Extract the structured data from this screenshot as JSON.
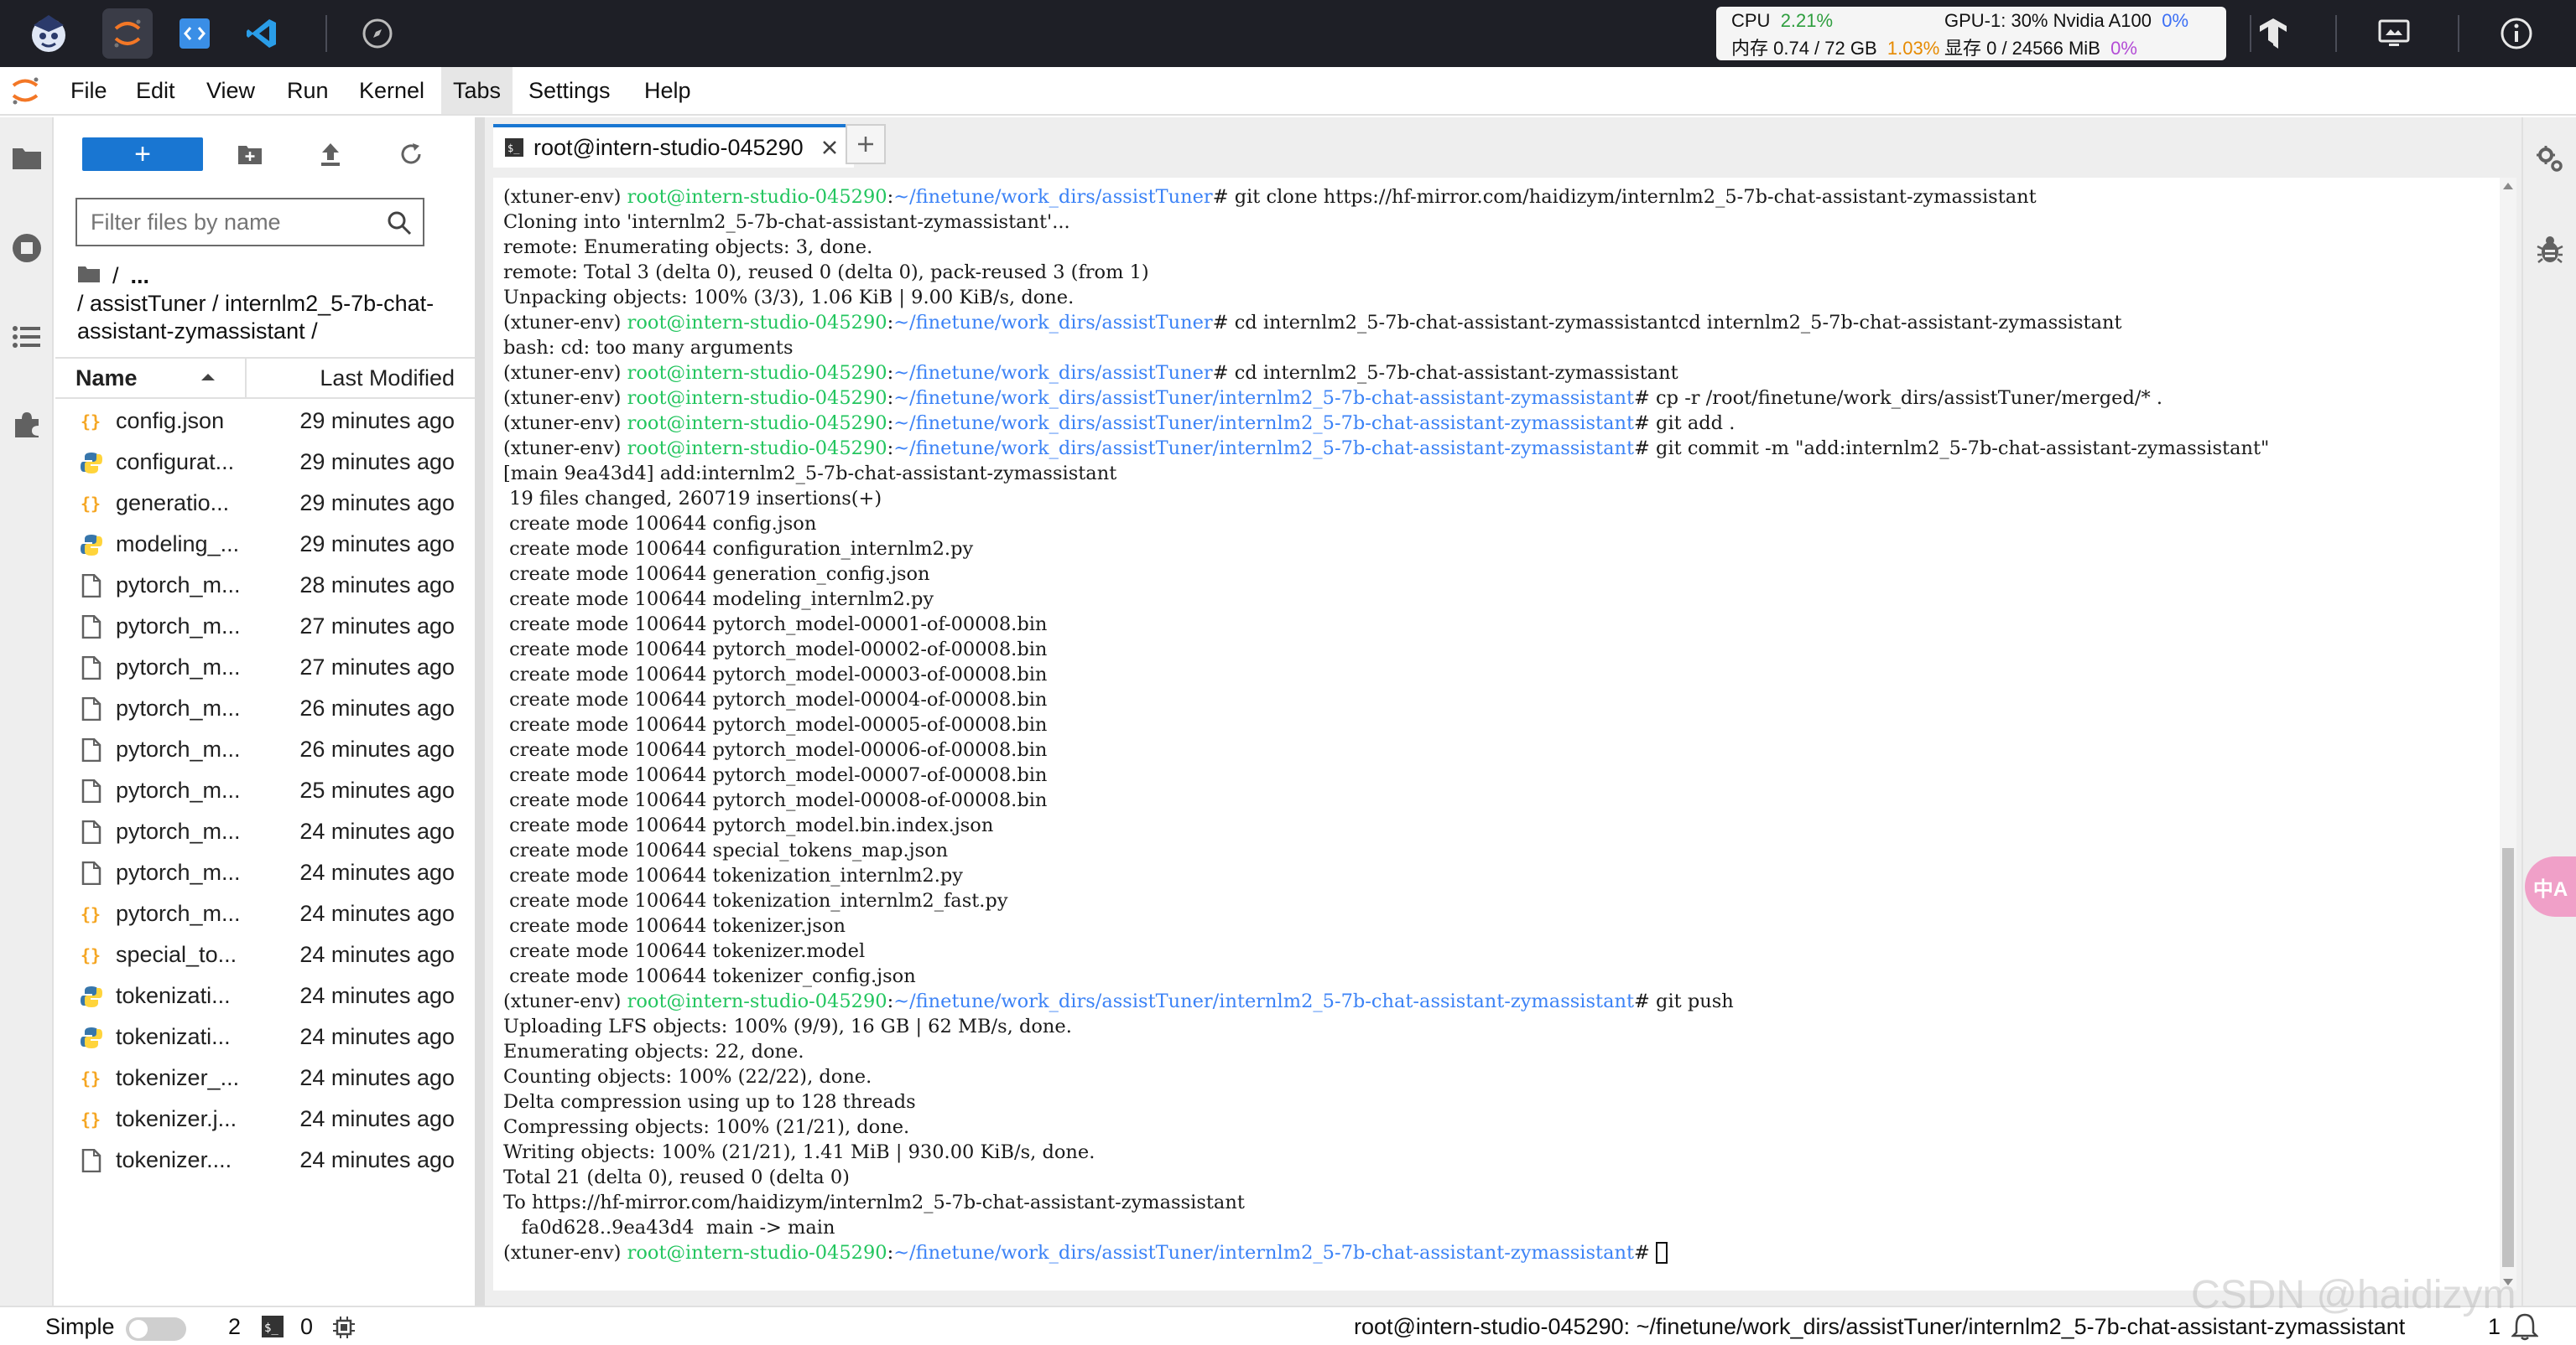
{
  "topbar": {
    "monitor": {
      "cpu_label": "CPU",
      "cpu_value": "2.21%",
      "mem_label": "内存 0.74 / 72 GB",
      "mem_value": "1.03%",
      "gpu_label": "GPU-1: 30% Nvidia A100",
      "gpu_value": "0%",
      "vram_label": "显存 0 / 24566 MiB",
      "vram_value": "0%"
    }
  },
  "menu": {
    "items": [
      "File",
      "Edit",
      "View",
      "Run",
      "Kernel",
      "Tabs",
      "Settings",
      "Help"
    ]
  },
  "filebrowser": {
    "new_button": "+",
    "search_placeholder": "Filter files by name",
    "crumb_root": "/",
    "crumb_ellipsis": "...",
    "path": "/ assistTuner / internlm2_5-7b-chat-assistant-zymassistant /",
    "header_name": "Name",
    "header_modified": "Last Modified",
    "files": [
      {
        "name": "config.json",
        "modified": "29 minutes ago",
        "icon": "json-icon"
      },
      {
        "name": "configurat...",
        "modified": "29 minutes ago",
        "icon": "python-icon"
      },
      {
        "name": "generatio...",
        "modified": "29 minutes ago",
        "icon": "json-icon"
      },
      {
        "name": "modeling_...",
        "modified": "29 minutes ago",
        "icon": "python-icon"
      },
      {
        "name": "pytorch_m...",
        "modified": "28 minutes ago",
        "icon": "file-icon"
      },
      {
        "name": "pytorch_m...",
        "modified": "27 minutes ago",
        "icon": "file-icon"
      },
      {
        "name": "pytorch_m...",
        "modified": "27 minutes ago",
        "icon": "file-icon"
      },
      {
        "name": "pytorch_m...",
        "modified": "26 minutes ago",
        "icon": "file-icon"
      },
      {
        "name": "pytorch_m...",
        "modified": "26 minutes ago",
        "icon": "file-icon"
      },
      {
        "name": "pytorch_m...",
        "modified": "25 minutes ago",
        "icon": "file-icon"
      },
      {
        "name": "pytorch_m...",
        "modified": "24 minutes ago",
        "icon": "file-icon"
      },
      {
        "name": "pytorch_m...",
        "modified": "24 minutes ago",
        "icon": "file-icon"
      },
      {
        "name": "pytorch_m...",
        "modified": "24 minutes ago",
        "icon": "json-icon"
      },
      {
        "name": "special_to...",
        "modified": "24 minutes ago",
        "icon": "json-icon"
      },
      {
        "name": "tokenizati...",
        "modified": "24 minutes ago",
        "icon": "python-icon"
      },
      {
        "name": "tokenizati...",
        "modified": "24 minutes ago",
        "icon": "python-icon"
      },
      {
        "name": "tokenizer_...",
        "modified": "24 minutes ago",
        "icon": "json-icon"
      },
      {
        "name": "tokenizer.j...",
        "modified": "24 minutes ago",
        "icon": "json-icon"
      },
      {
        "name": "tokenizer....",
        "modified": "24 minutes ago",
        "icon": "file-icon"
      }
    ]
  },
  "tabs": {
    "active_label": "root@intern-studio-045290",
    "add_label": "+"
  },
  "terminal": {
    "lines": [
      {
        "env": "(xtuner-env) ",
        "host": "root@intern-studio-045290",
        "sep": ":",
        "path": "~/finetune/work_dirs/assistTuner",
        "cmd": "# git clone https://hf-mirror.com/haidizym/internlm2_5-7b-chat-assistant-zymassistant"
      },
      {
        "text": "Cloning into 'internlm2_5-7b-chat-assistant-zymassistant'..."
      },
      {
        "text": "remote: Enumerating objects: 3, done."
      },
      {
        "text": "remote: Total 3 (delta 0), reused 0 (delta 0), pack-reused 3 (from 1)"
      },
      {
        "text": "Unpacking objects: 100% (3/3), 1.06 KiB | 9.00 KiB/s, done."
      },
      {
        "env": "(xtuner-env) ",
        "host": "root@intern-studio-045290",
        "sep": ":",
        "path": "~/finetune/work_dirs/assistTuner",
        "cmd": "# cd internlm2_5-7b-chat-assistant-zymassistantcd internlm2_5-7b-chat-assistant-zymassistant"
      },
      {
        "text": "bash: cd: too many arguments"
      },
      {
        "env": "(xtuner-env) ",
        "host": "root@intern-studio-045290",
        "sep": ":",
        "path": "~/finetune/work_dirs/assistTuner",
        "cmd": "# cd internlm2_5-7b-chat-assistant-zymassistant"
      },
      {
        "env": "(xtuner-env) ",
        "host": "root@intern-studio-045290",
        "sep": ":",
        "path": "~/finetune/work_dirs/assistTuner/internlm2_5-7b-chat-assistant-zymassistant",
        "cmd": "# cp -r /root/finetune/work_dirs/assistTuner/merged/* ."
      },
      {
        "env": "(xtuner-env) ",
        "host": "root@intern-studio-045290",
        "sep": ":",
        "path": "~/finetune/work_dirs/assistTuner/internlm2_5-7b-chat-assistant-zymassistant",
        "cmd": "# git add ."
      },
      {
        "env": "(xtuner-env) ",
        "host": "root@intern-studio-045290",
        "sep": ":",
        "path": "~/finetune/work_dirs/assistTuner/internlm2_5-7b-chat-assistant-zymassistant",
        "cmd": "# git commit -m \"add:internlm2_5-7b-chat-assistant-zymassistant\""
      },
      {
        "text": "[main 9ea43d4] add:internlm2_5-7b-chat-assistant-zymassistant"
      },
      {
        "text": " 19 files changed, 260719 insertions(+)"
      },
      {
        "text": " create mode 100644 config.json"
      },
      {
        "text": " create mode 100644 configuration_internlm2.py"
      },
      {
        "text": " create mode 100644 generation_config.json"
      },
      {
        "text": " create mode 100644 modeling_internlm2.py"
      },
      {
        "text": " create mode 100644 pytorch_model-00001-of-00008.bin"
      },
      {
        "text": " create mode 100644 pytorch_model-00002-of-00008.bin"
      },
      {
        "text": " create mode 100644 pytorch_model-00003-of-00008.bin"
      },
      {
        "text": " create mode 100644 pytorch_model-00004-of-00008.bin"
      },
      {
        "text": " create mode 100644 pytorch_model-00005-of-00008.bin"
      },
      {
        "text": " create mode 100644 pytorch_model-00006-of-00008.bin"
      },
      {
        "text": " create mode 100644 pytorch_model-00007-of-00008.bin"
      },
      {
        "text": " create mode 100644 pytorch_model-00008-of-00008.bin"
      },
      {
        "text": " create mode 100644 pytorch_model.bin.index.json"
      },
      {
        "text": " create mode 100644 special_tokens_map.json"
      },
      {
        "text": " create mode 100644 tokenization_internlm2.py"
      },
      {
        "text": " create mode 100644 tokenization_internlm2_fast.py"
      },
      {
        "text": " create mode 100644 tokenizer.json"
      },
      {
        "text": " create mode 100644 tokenizer.model"
      },
      {
        "text": " create mode 100644 tokenizer_config.json"
      },
      {
        "env": "(xtuner-env) ",
        "host": "root@intern-studio-045290",
        "sep": ":",
        "path": "~/finetune/work_dirs/assistTuner/internlm2_5-7b-chat-assistant-zymassistant",
        "cmd": "# git push"
      },
      {
        "text": "Uploading LFS objects: 100% (9/9), 16 GB | 62 MB/s, done."
      },
      {
        "text": "Enumerating objects: 22, done."
      },
      {
        "text": "Counting objects: 100% (22/22), done."
      },
      {
        "text": "Delta compression using up to 128 threads"
      },
      {
        "text": "Compressing objects: 100% (21/21), done."
      },
      {
        "text": "Writing objects: 100% (21/21), 1.41 MiB | 930.00 KiB/s, done."
      },
      {
        "text": "Total 21 (delta 0), reused 0 (delta 0)"
      },
      {
        "text": "To https://hf-mirror.com/haidizym/internlm2_5-7b-chat-assistant-zymassistant"
      },
      {
        "text": "   fa0d628..9ea43d4  main -> main"
      },
      {
        "env": "(xtuner-env) ",
        "host": "root@intern-studio-045290",
        "sep": ":",
        "path": "~/finetune/work_dirs/assistTuner/internlm2_5-7b-chat-assistant-zymassistant",
        "cmd": "# ",
        "cursor": true
      }
    ]
  },
  "statusbar": {
    "simple_label": "Simple",
    "kernels_count": "2",
    "terminals_count": "0",
    "path": "root@intern-studio-045290: ~/finetune/work_dirs/assistTuner/internlm2_5-7b-chat-assistant-zymassistant",
    "line_count": "1"
  },
  "watermark": "CSDN @haidizym",
  "translate_label": "中A",
  "colors": {
    "accent": "#1976d2",
    "host_green": "#22c55e",
    "path_blue": "#3b82f6",
    "topbar": "#1e1f26"
  }
}
